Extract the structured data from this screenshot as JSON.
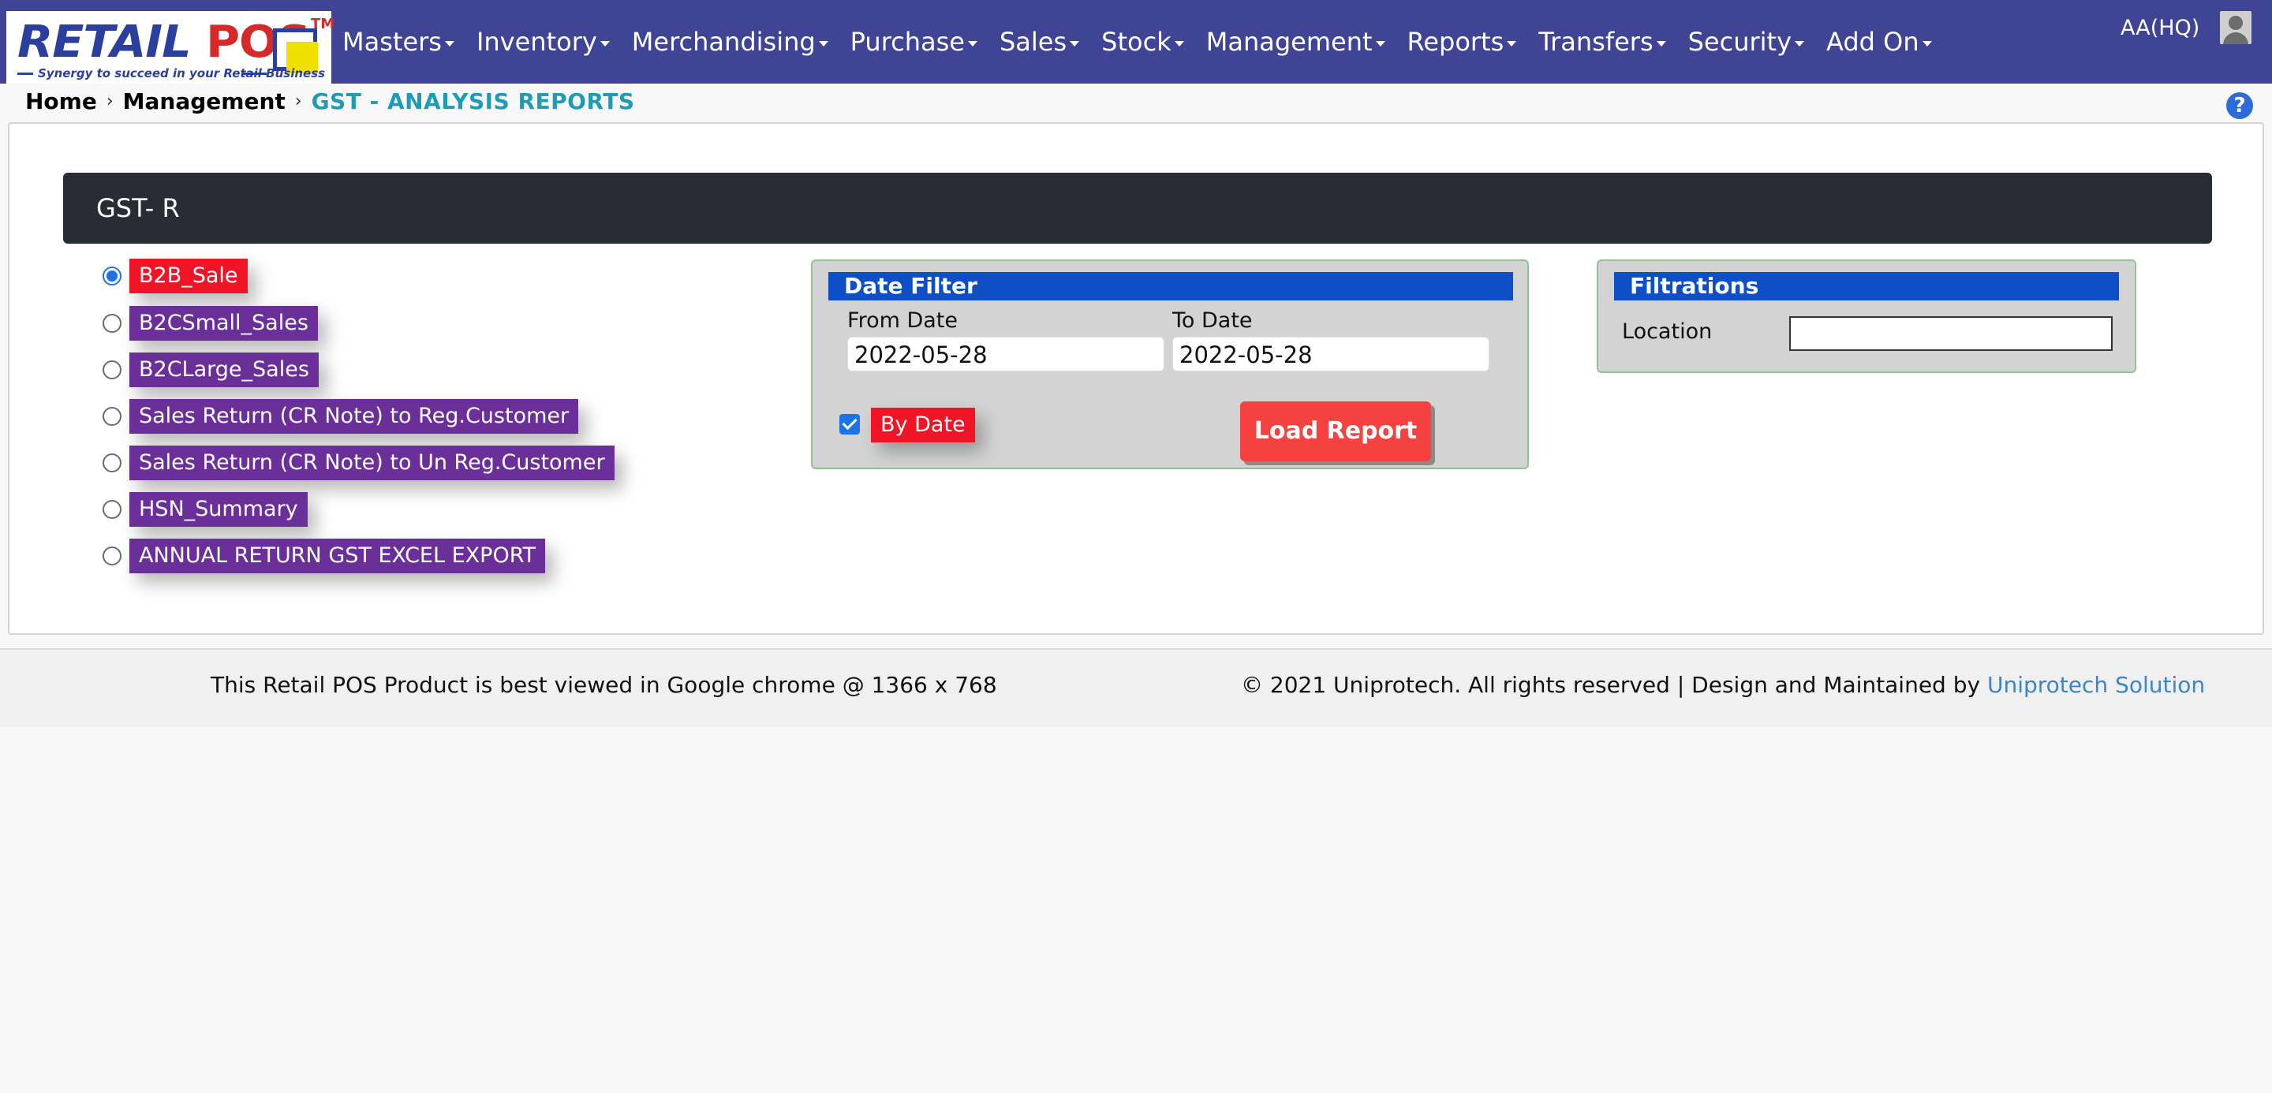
{
  "logo": {
    "brand_left": "RETAIL",
    "brand_right": "POS",
    "tm": "TM",
    "tagline": "Synergy to succeed in your Retail Business"
  },
  "nav": {
    "items": [
      {
        "label": "Masters"
      },
      {
        "label": "Inventory"
      },
      {
        "label": "Merchandising"
      },
      {
        "label": "Purchase"
      },
      {
        "label": "Sales"
      },
      {
        "label": "Stock"
      },
      {
        "label": "Management"
      },
      {
        "label": "Reports"
      },
      {
        "label": "Transfers"
      },
      {
        "label": "Security"
      },
      {
        "label": "Add On"
      }
    ],
    "user": "AA(HQ)"
  },
  "breadcrumb": {
    "home": "Home",
    "section": "Management",
    "current": "GST - ANALYSIS REPORTS",
    "help": "?"
  },
  "panel": {
    "title": "GST- R"
  },
  "reports": [
    {
      "label": "B2B_Sale",
      "selected": true
    },
    {
      "label": "B2CSmall_Sales",
      "selected": false
    },
    {
      "label": "B2CLarge_Sales",
      "selected": false
    },
    {
      "label": "Sales Return (CR Note) to Reg.Customer",
      "selected": false
    },
    {
      "label": "Sales Return (CR Note) to Un Reg.Customer",
      "selected": false
    },
    {
      "label": "HSN_Summary",
      "selected": false
    },
    {
      "label": "ANNUAL RETURN GST EXCEL EXPORT",
      "selected": false
    }
  ],
  "date_filter": {
    "title": "Date Filter",
    "from_label": "From Date",
    "from_value": "2022-05-28",
    "to_label": "To Date",
    "to_value": "2022-05-28",
    "by_date_label": "By Date",
    "by_date_checked": true,
    "load_button": "Load Report"
  },
  "filtrations": {
    "title": "Filtrations",
    "location_label": "Location",
    "location_value": ""
  },
  "footer": {
    "left": "This Retail POS Product is best viewed in Google chrome @ 1366 x 768",
    "right_text": "© 2021 Uniprotech. All rights reserved | Design and Maintained by ",
    "right_link": "Uniprotech Solution"
  },
  "colors": {
    "navbar": "#3f4494",
    "panel_header": "#282d35",
    "tag_purple": "#6b2f9a",
    "tag_red": "#ef1526",
    "box_title": "#0f4fc6",
    "load_button": "#f5413f",
    "breadcrumb_current": "#1f9cb5",
    "footer_link": "#3b86c6"
  }
}
